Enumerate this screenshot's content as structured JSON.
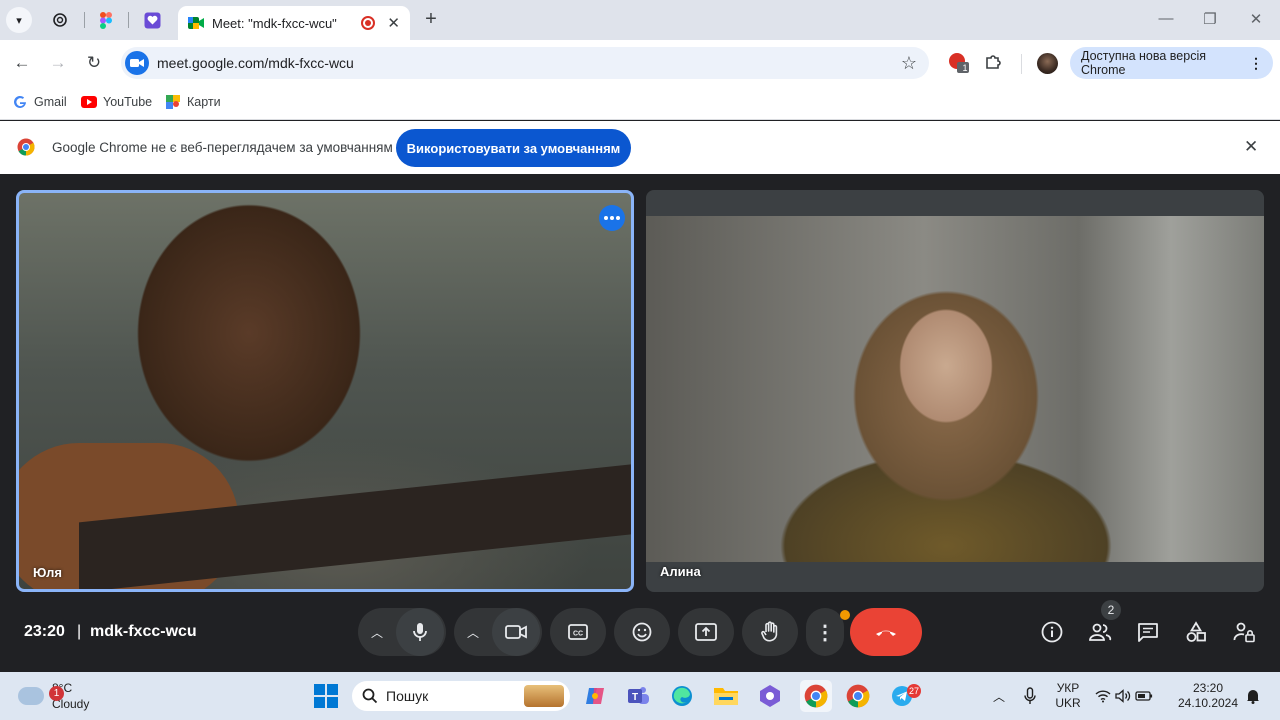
{
  "browser": {
    "active_tab_title": "Meet: \"mdk-fxcc-wcu\"",
    "tab_close": "✕",
    "new_tab": "+",
    "url": "meet.google.com/mdk-fxcc-wcu",
    "update_label": "Доступна нова версія Chrome",
    "extension_badge": "1",
    "window_controls": {
      "minimize": "—",
      "restore": "❐",
      "close": "✕"
    }
  },
  "bookmarks": [
    {
      "label": "Gmail"
    },
    {
      "label": "YouTube"
    },
    {
      "label": "Карти"
    }
  ],
  "infobar": {
    "message": "Google Chrome не є веб-переглядачем за умовчанням",
    "button": "Використовувати за умовчанням",
    "close": "✕"
  },
  "meet": {
    "participants": [
      {
        "name": "Юля",
        "active_speaker": true
      },
      {
        "name": "Алина",
        "active_speaker": false
      }
    ],
    "time": "23:20",
    "separator": "|",
    "meeting_code": "mdk-fxcc-wcu",
    "people_count": "2",
    "controls": [
      "microphone-icon",
      "camera-icon",
      "captions-icon",
      "emoji-icon",
      "present-icon",
      "raise-hand-icon",
      "more-options-icon",
      "end-call-icon"
    ],
    "accent": "#8ab4f8",
    "end_call_color": "#ea4335"
  },
  "taskbar": {
    "weather_temp": "8°C",
    "weather_desc": "Cloudy",
    "weather_badge": "1",
    "search_placeholder": "Пошук",
    "telegram_badge": "27",
    "language_top": "УКР",
    "language_bottom": "UKR",
    "clock_time": "23:20",
    "clock_date": "24.10.2024"
  }
}
